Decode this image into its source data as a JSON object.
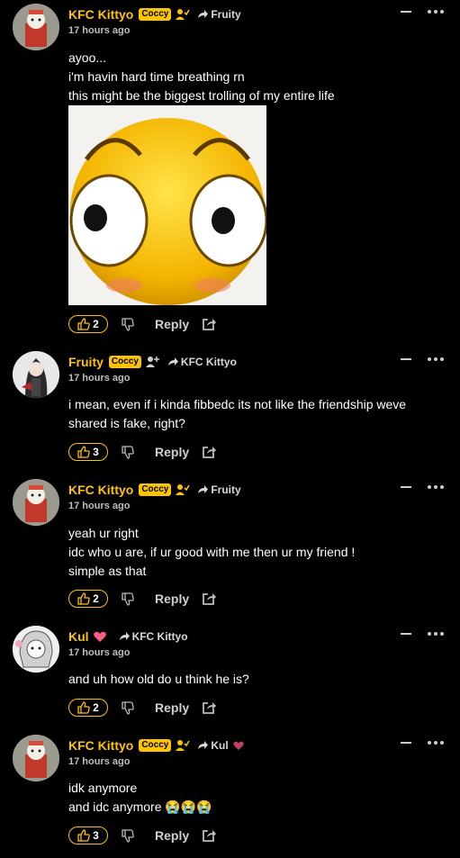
{
  "comments": [
    {
      "username": "KFC Kittyo",
      "badge": "Coccy",
      "reply_to": "Fruity",
      "time": "17 hours ago",
      "lines": [
        "ayoo...",
        "i'm havin hard time breathing rn",
        "this might be the biggest trolling of my entire life"
      ],
      "likes": "2",
      "reply_label": "Reply"
    },
    {
      "username": "Fruity",
      "badge": "Coccy",
      "reply_to": "KFC Kittyo",
      "time": "17 hours ago",
      "lines": [
        "i mean, even if i kinda fibbedc its not like the friendship weve",
        "shared is fake, right?"
      ],
      "likes": "3",
      "reply_label": "Reply"
    },
    {
      "username": "KFC Kittyo",
      "badge": "Coccy",
      "reply_to": "Fruity",
      "time": "17 hours ago",
      "lines": [
        "yeah ur right",
        "idc who u are, if ur good with me then ur my friend !",
        "simple as that"
      ],
      "likes": "2",
      "reply_label": "Reply"
    },
    {
      "username": "Kul",
      "reply_to": "KFC Kittyo",
      "time": "17 hours ago",
      "lines": [
        "and uh how old do u think he is?"
      ],
      "likes": "2",
      "reply_label": "Reply"
    },
    {
      "username": "KFC Kittyo",
      "badge": "Coccy",
      "reply_to": "Kul",
      "time": "17 hours ago",
      "lines": [
        "idk anymore",
        "and idc anymore 😭😭😭"
      ],
      "likes": "3",
      "reply_label": "Reply"
    }
  ],
  "colors": {
    "accent": "#ffc400",
    "background": "#000000",
    "heart": "#ff5c8a"
  },
  "icons": [
    "thumbs-up-icon",
    "thumbs-down-icon",
    "share-icon",
    "follow-user-icon",
    "reply-arrow-icon",
    "heart-icon",
    "more-icon",
    "collapse-icon"
  ]
}
